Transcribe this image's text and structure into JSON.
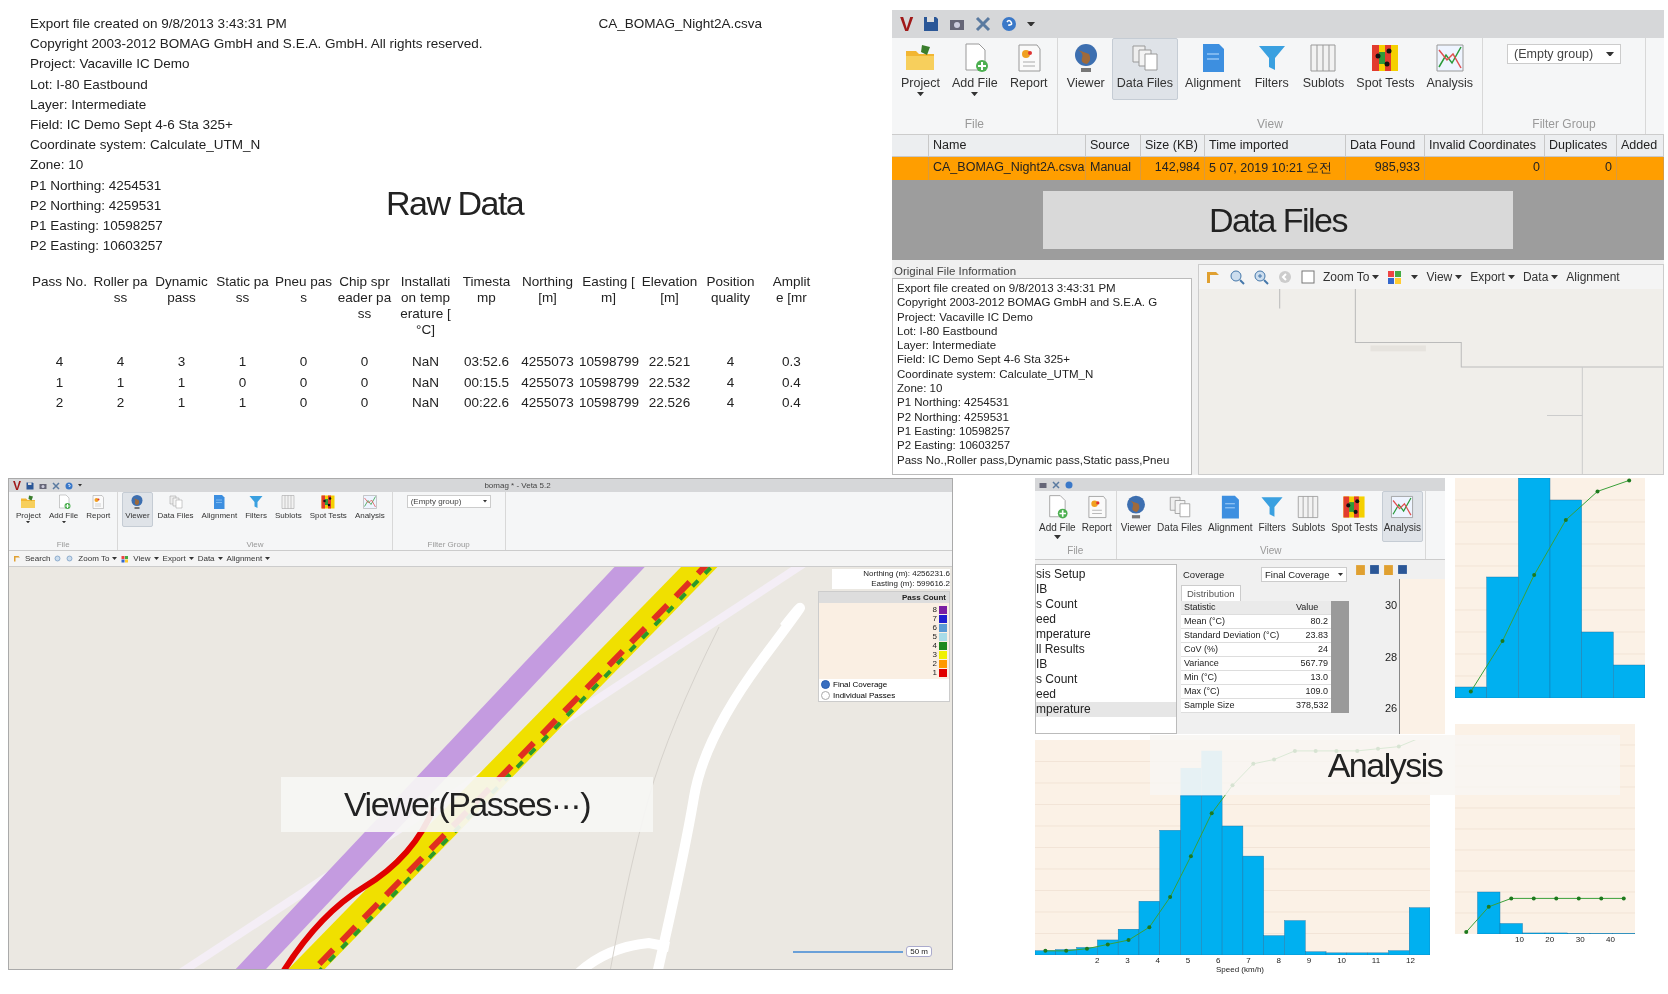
{
  "raw_data": {
    "header_lines": [
      "Export file created on 9/8/2013 3:43:31 PM",
      "Copyright 2003-2012 BOMAG GmbH and S.E.A. GmbH. All rights reserved.",
      "Project: Vacaville IC Demo",
      "Lot: I-80 Eastbound",
      "Layer: Intermediate",
      "Field: IC Demo Sept 4-6 Sta 325+",
      "Coordinate system: Calculate_UTM_N",
      "Zone: 10",
      "P1 Northing: 4254531",
      "P2 Northing: 4259531",
      "P1 Easting: 10598257",
      "P2 Easting: 10603257"
    ],
    "file_name": "CA_BOMAG_Night2A.csva",
    "caption": "Raw Data",
    "columns": [
      {
        "lines": [
          "Pass No."
        ]
      },
      {
        "lines": [
          "Roller pa",
          "ss"
        ]
      },
      {
        "lines": [
          "Dynamic",
          "pass"
        ]
      },
      {
        "lines": [
          "Static pa",
          "ss"
        ]
      },
      {
        "lines": [
          "Pneu pas",
          "s"
        ]
      },
      {
        "lines": [
          "Chip spr",
          "eader pa",
          "ss"
        ]
      },
      {
        "lines": [
          "Installati",
          "on temp",
          "erature [",
          "°C]"
        ]
      },
      {
        "lines": [
          "Timesta",
          "mp"
        ]
      },
      {
        "lines": [
          "Northing",
          "[m]"
        ]
      },
      {
        "lines": [
          "Easting [",
          "m]"
        ]
      },
      {
        "lines": [
          "Elevation",
          "[m]"
        ]
      },
      {
        "lines": [
          "Position",
          "quality"
        ]
      },
      {
        "lines": [
          "Amplit",
          "e [mr"
        ]
      }
    ],
    "rows": [
      [
        "4",
        "4",
        "3",
        "1",
        "0",
        "0",
        "NaN",
        "03:52.6",
        "4255073",
        "10598799",
        "22.521",
        "4",
        "0.3"
      ],
      [
        "1",
        "1",
        "1",
        "0",
        "0",
        "0",
        "NaN",
        "00:15.5",
        "4255073",
        "10598799",
        "22.532",
        "4",
        "0.4"
      ],
      [
        "2",
        "2",
        "1",
        "1",
        "0",
        "0",
        "NaN",
        "00:22.6",
        "4255073",
        "10598799",
        "22.526",
        "4",
        "0.4"
      ]
    ]
  },
  "data_files_app": {
    "logo": "V",
    "ribbon": {
      "groups": [
        {
          "label": "File",
          "items": [
            {
              "label": "Project",
              "selected": false,
              "dropdown": true
            },
            {
              "label": "Add File",
              "selected": false,
              "dropdown": true
            },
            {
              "label": "Report",
              "selected": false,
              "dropdown": false
            }
          ]
        },
        {
          "label": "View",
          "items": [
            {
              "label": "Viewer",
              "selected": false,
              "dropdown": false
            },
            {
              "label": "Data Files",
              "selected": true,
              "dropdown": false
            },
            {
              "label": "Alignment",
              "selected": false,
              "dropdown": false
            },
            {
              "label": "Filters",
              "selected": false,
              "dropdown": false
            },
            {
              "label": "Sublots",
              "selected": false,
              "dropdown": false
            },
            {
              "label": "Spot Tests",
              "selected": false,
              "dropdown": false
            },
            {
              "label": "Analysis",
              "selected": false,
              "dropdown": false
            }
          ]
        },
        {
          "label": "Filter Group",
          "dropdown_value": "(Empty group)"
        }
      ]
    },
    "table": {
      "columns": [
        "Name",
        "Source",
        "Size (KB)",
        "Time imported",
        "Data Found",
        "Invalid Coordinates",
        "Duplicates",
        "Added"
      ],
      "rows": [
        {
          "selected": true,
          "cells": [
            "CA_BOMAG_Night2A.csva",
            "Manual",
            "142,984",
            "5 07, 2019 10:21 오전",
            "985,933",
            "0",
            "0"
          ]
        }
      ]
    },
    "caption": "Data Files",
    "file_info": {
      "title": "Original File Information",
      "lines": [
        "Export file created on 9/8/2013 3:43:31 PM",
        "Copyright 2003-2012 BOMAG GmbH and S.E.A. G",
        "Project: Vacaville IC Demo",
        "Lot: I-80 Eastbound",
        "Layer: Intermediate",
        "Field: IC Demo Sept 4-6 Sta 325+",
        "Coordinate system: Calculate_UTM_N",
        "Zone: 10",
        "P1 Northing: 4254531",
        "P2 Northing: 4259531",
        "P1 Easting: 10598257",
        "P2 Easting: 10603257",
        "Pass No.,Roller pass,Dynamic pass,Static pass,Pneu"
      ]
    },
    "map_toolbar": [
      {
        "label": "Zoom To",
        "dropdown": true
      },
      {
        "label": "View",
        "dropdown": true
      },
      {
        "label": "Export",
        "dropdown": true
      },
      {
        "label": "Data",
        "dropdown": true
      },
      {
        "label": "Alignment",
        "dropdown": false
      }
    ]
  },
  "viewer_app": {
    "logo": "V",
    "title": "bomag * - Veta 5.2",
    "ribbon": {
      "groups": [
        {
          "label": "File",
          "items": [
            {
              "label": "Project",
              "selected": false,
              "dropdown": true
            },
            {
              "label": "Add File",
              "selected": false,
              "dropdown": true
            },
            {
              "label": "Report",
              "selected": false,
              "dropdown": false
            }
          ]
        },
        {
          "label": "View",
          "items": [
            {
              "label": "Viewer",
              "selected": true,
              "dropdown": false
            },
            {
              "label": "Data Files",
              "selected": false,
              "dropdown": false
            },
            {
              "label": "Alignment",
              "selected": false,
              "dropdown": false
            },
            {
              "label": "Filters",
              "selected": false,
              "dropdown": false
            },
            {
              "label": "Sublots",
              "selected": false,
              "dropdown": false
            },
            {
              "label": "Spot Tests",
              "selected": false,
              "dropdown": false
            },
            {
              "label": "Analysis",
              "selected": false,
              "dropdown": false
            }
          ]
        },
        {
          "label": "Filter Group",
          "dropdown_value": "(Empty group)"
        }
      ]
    },
    "toolbar": [
      {
        "label": "Search",
        "dropdown": false
      },
      {
        "label": "Zoom To",
        "dropdown": true
      },
      {
        "label": "View",
        "dropdown": true
      },
      {
        "label": "Export",
        "dropdown": true
      },
      {
        "label": "Data",
        "dropdown": true
      },
      {
        "label": "Alignment",
        "dropdown": true
      }
    ],
    "coordinates": [
      "Northing (m): 4256231.6",
      "Easting (m): 599616.2"
    ],
    "legend": {
      "title": "Pass Count",
      "items": [
        {
          "label": "8",
          "color": "#7b1fa2"
        },
        {
          "label": "7",
          "color": "#1f1fd0"
        },
        {
          "label": "6",
          "color": "#5b9bd5"
        },
        {
          "label": "5",
          "color": "#a8dce8"
        },
        {
          "label": "4",
          "color": "#1e8a1e"
        },
        {
          "label": "3",
          "color": "#f0f000"
        },
        {
          "label": "2",
          "color": "#ff9900"
        },
        {
          "label": "1",
          "color": "#e00000"
        }
      ]
    },
    "modes": [
      {
        "label": "Final Coverage",
        "selected": true
      },
      {
        "label": "Individual Passes",
        "selected": false
      }
    ],
    "scale": "50 m",
    "caption": "Viewer(Passes···)"
  },
  "analysis_app": {
    "ribbon": {
      "groups": [
        {
          "label": "File",
          "items": [
            {
              "label": "Add File",
              "selected": false,
              "dropdown": true
            },
            {
              "label": "Report",
              "selected": false,
              "dropdown": false
            }
          ]
        },
        {
          "label": "View",
          "items": [
            {
              "label": "Viewer",
              "selected": false,
              "dropdown": false
            },
            {
              "label": "Data Files",
              "selected": false,
              "dropdown": false
            },
            {
              "label": "Alignment",
              "selected": false,
              "dropdown": false
            },
            {
              "label": "Filters",
              "selected": false,
              "dropdown": false
            },
            {
              "label": "Sublots",
              "selected": false,
              "dropdown": false
            },
            {
              "label": "Spot Tests",
              "selected": false,
              "dropdown": false
            },
            {
              "label": "Analysis",
              "selected": true,
              "dropdown": false
            }
          ]
        }
      ]
    },
    "tree": [
      {
        "label": "sis Setup",
        "selected": false
      },
      {
        "label": "IB",
        "selected": false
      },
      {
        "label": "s Count",
        "selected": false
      },
      {
        "label": "eed",
        "selected": false
      },
      {
        "label": "mperature",
        "selected": false
      },
      {
        "label": "ll Results",
        "selected": false
      },
      {
        "label": "IB",
        "selected": false
      },
      {
        "label": "s Count",
        "selected": false
      },
      {
        "label": "eed",
        "selected": false
      },
      {
        "label": "mperature",
        "selected": true
      }
    ],
    "coverage": {
      "label": "Coverage",
      "value": "Final Coverage"
    },
    "tabs": [
      {
        "label": "Distribution",
        "selected": true
      }
    ],
    "stats": {
      "columns": [
        "Statistic",
        "Value"
      ],
      "rows": [
        [
          "Mean (°C)",
          "80.2"
        ],
        [
          "Standard Deviation (°C)",
          "23.83"
        ],
        [
          "CoV (%)",
          "24"
        ],
        [
          "Variance",
          "567.79"
        ],
        [
          "Min (°C)",
          "13.0"
        ],
        [
          "Max (°C)",
          "109.0"
        ],
        [
          "Sample Size",
          "378,532"
        ]
      ]
    },
    "side_ticks": [
      "30",
      "28",
      "26"
    ],
    "histogram_ticks": [
      "2",
      "3",
      "4",
      "5",
      "6",
      "7",
      "8",
      "9",
      "10",
      "11",
      "12"
    ],
    "histogram_xlabel": "Speed (km/h)",
    "small_ticks": [
      "10",
      "20",
      "30",
      "40"
    ],
    "caption": "Analysis"
  }
}
